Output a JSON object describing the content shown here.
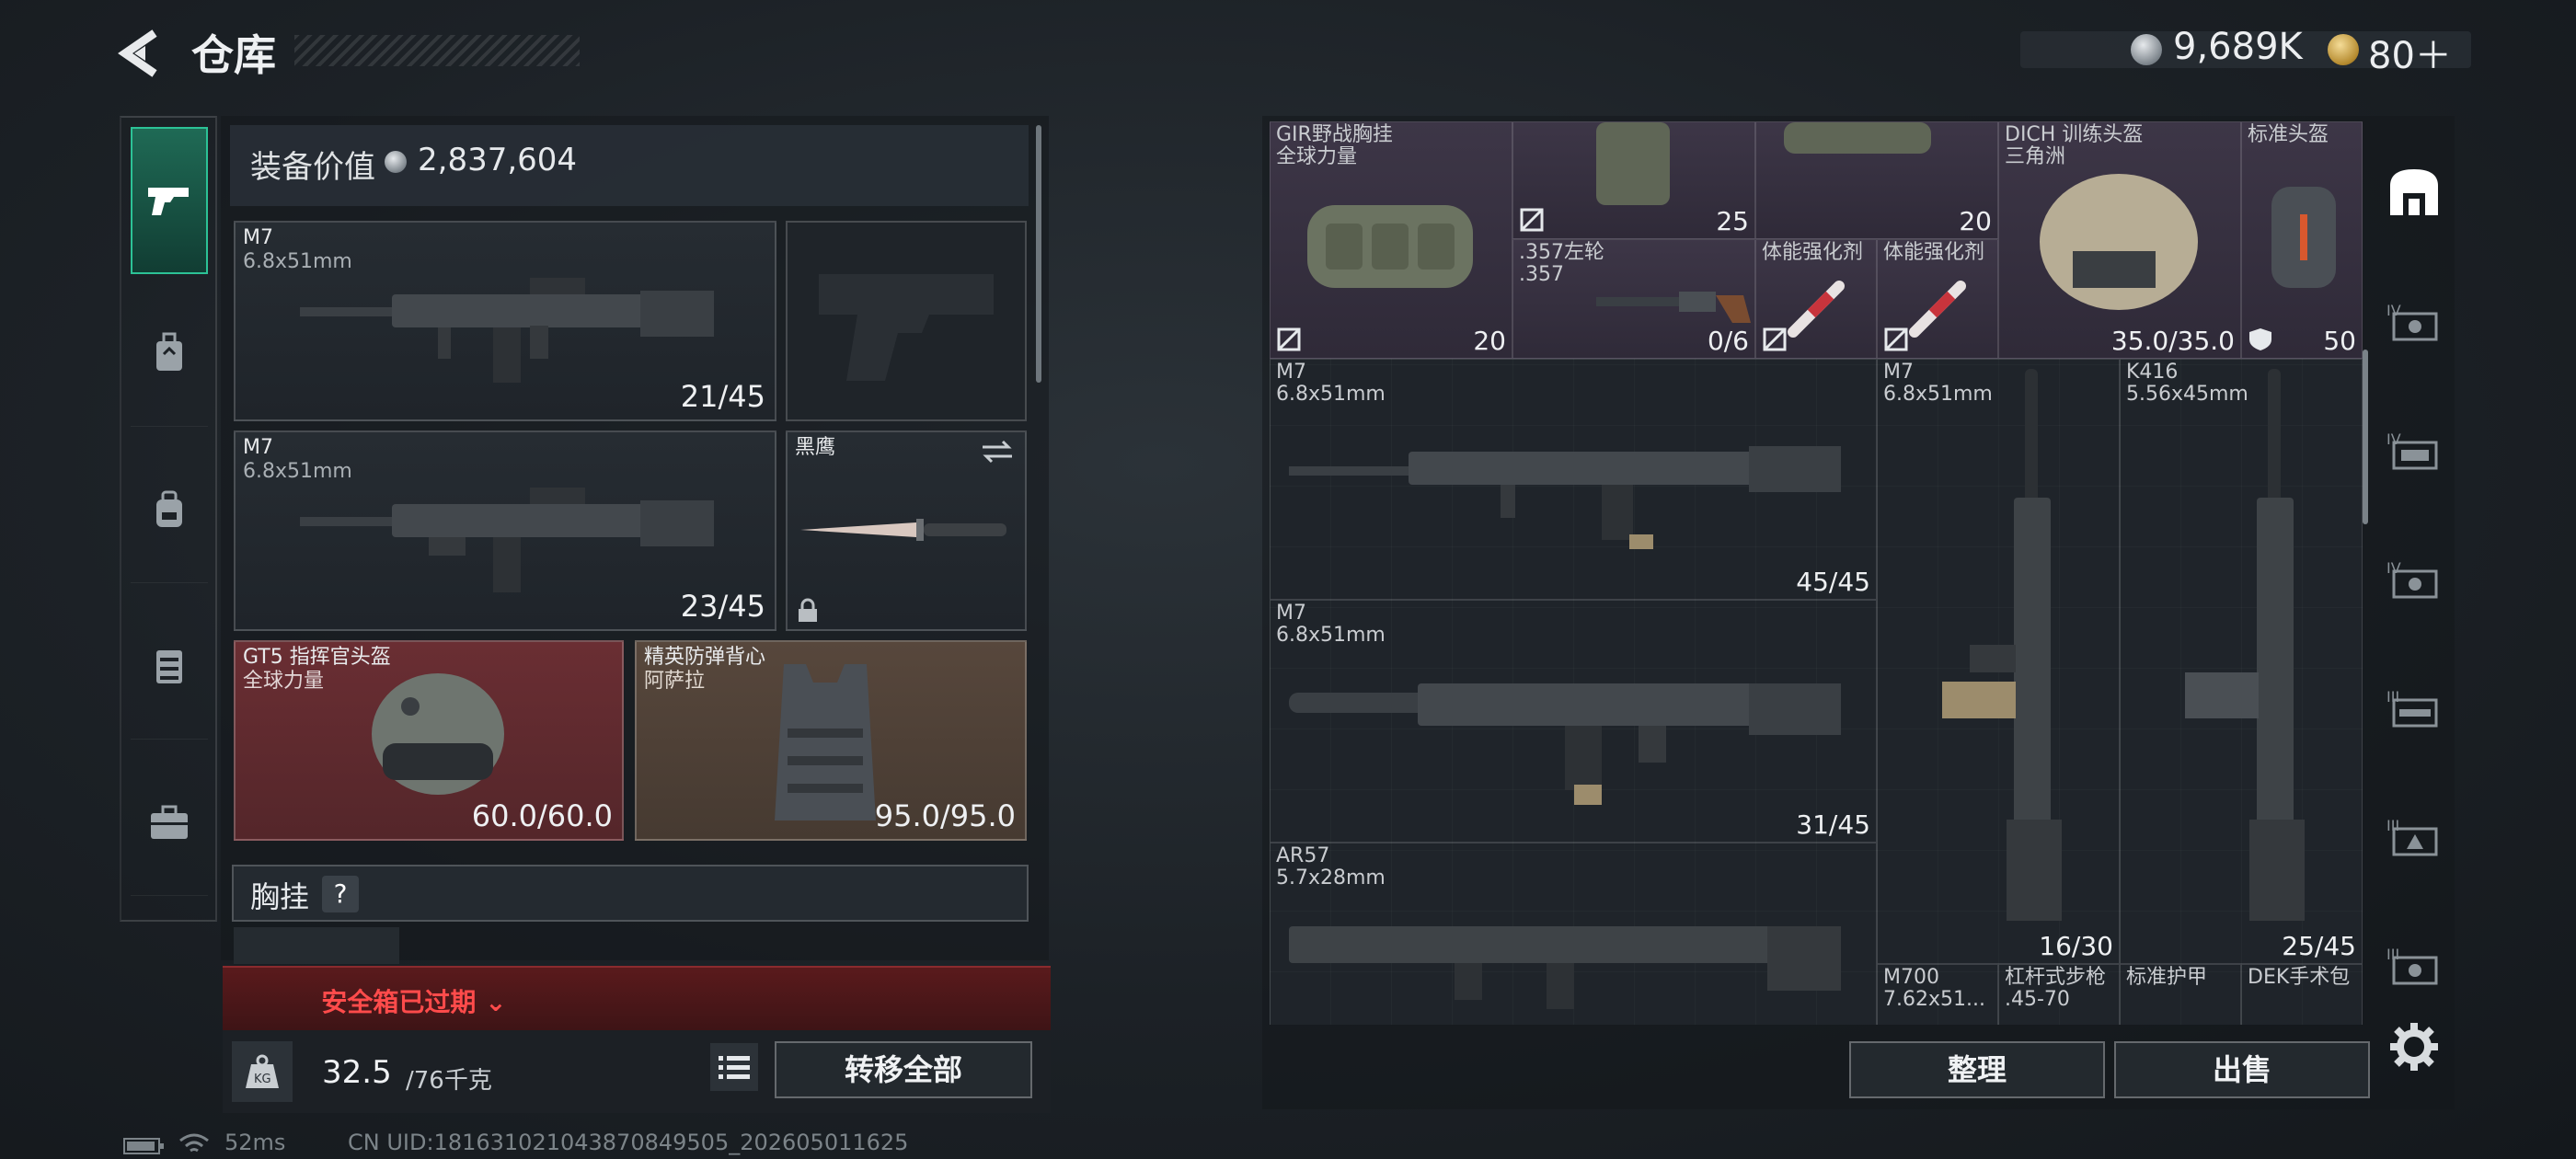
{
  "header": {
    "title": "仓库"
  },
  "currency": {
    "silver": "9,689K",
    "gold": "80＋"
  },
  "left_nav": {
    "items": [
      "weapons",
      "helmet",
      "backpack",
      "armor-vest",
      "briefcase"
    ]
  },
  "loadout": {
    "equip_value_label": "装备价值",
    "equip_value": "2,837,604",
    "primary": {
      "name": "M7",
      "caliber": "6.8x51mm",
      "ammo": "21/45"
    },
    "secondary": {
      "name": "M7",
      "caliber": "6.8x51mm",
      "ammo": "23/45"
    },
    "knife": {
      "name": "黑鹰"
    },
    "helmet": {
      "name": "GT5 指挥官头盔",
      "faction": "全球力量",
      "durability": "60.0/60.0"
    },
    "armor": {
      "name": "精英防弹背心",
      "faction": "阿萨拉",
      "durability": "95.0/95.0"
    },
    "chest_label": "胸挂",
    "chest_help": "?"
  },
  "safe_box": {
    "text": "安全箱已过期 ⌄"
  },
  "bottom": {
    "weight": "32.5",
    "weight_max": "/76千克",
    "transfer_all": "转移全部"
  },
  "status": {
    "ping": "52ms",
    "uid": "CN UID:18163102104387084950​5_202605011625"
  },
  "stash": {
    "items": [
      {
        "name": "GIR野战胸挂",
        "sub": "全球力量",
        "value": "20",
        "icon": "no-trade-icon"
      },
      {
        "name": "",
        "sub": "",
        "value": "25"
      },
      {
        "name": "",
        "sub": "",
        "value": "20"
      },
      {
        "name": ".357左轮",
        "sub": ".357",
        "value": "0/6"
      },
      {
        "name": "体能强化剂",
        "sub": ""
      },
      {
        "name": "体能强化剂",
        "sub": ""
      },
      {
        "name": "DICH 训练头盔",
        "sub": "三角洲",
        "value": "35.0/35.0"
      },
      {
        "name": "标准头盔",
        "sub": "",
        "value": "50"
      },
      {
        "name": "M7",
        "sub": "6.8x51mm",
        "value": "45/45"
      },
      {
        "name": "M7",
        "sub": "6.8x51mm",
        "value": "31/45"
      },
      {
        "name": "AR57",
        "sub": "5.7x28mm"
      },
      {
        "name": "M7",
        "sub": "6.8x51mm",
        "value": "16/30"
      },
      {
        "name": "K416",
        "sub": "5.56x45mm",
        "value": "25/45"
      },
      {
        "name": "M700",
        "sub": "7.62x51..."
      },
      {
        "name": "杠杆式步枪",
        "sub": ".45-70"
      },
      {
        "name": "标准护甲",
        "sub": ""
      },
      {
        "name": "DEK手术包",
        "sub": ""
      }
    ]
  },
  "right_nav": {
    "levels": [
      "IV",
      "IV",
      "IV",
      "III",
      "III",
      "III"
    ]
  },
  "actions": {
    "sort": "整理",
    "sell": "出售"
  }
}
